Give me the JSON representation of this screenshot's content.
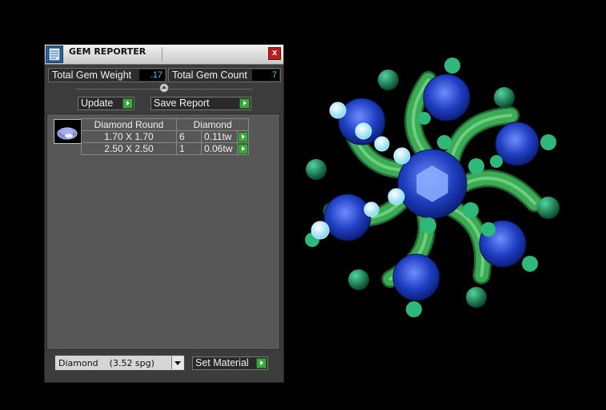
{
  "window": {
    "title": "GEM REPORTER",
    "close_label": "x"
  },
  "stats": {
    "total_weight_label": "Total Gem Weight",
    "total_weight_value": ".17",
    "total_count_label": "Total Gem Count",
    "total_count_value": "7"
  },
  "buttons": {
    "update_label": "Update",
    "save_report_label": "Save Report",
    "set_material_label": "Set Material"
  },
  "table": {
    "headers": [
      "Diamond Round",
      "Diamond"
    ],
    "rows": [
      {
        "size": "1.70 X 1.70",
        "count": "6",
        "weight": "0.11tw"
      },
      {
        "size": "2.50 X 2.50",
        "count": "1",
        "weight": "0.06tw"
      }
    ]
  },
  "material": {
    "selected": "Diamond    (3.52 spg)"
  },
  "colors": {
    "accent_green": "#3fa63f",
    "value_cyan": "#3fd2e6",
    "metal_green": "#3daa55",
    "sapphire_blue": "#1e3fc0"
  },
  "icons": {
    "app": "gem-reporter-icon",
    "close": "close-icon",
    "arrow": "green-arrow-icon",
    "dropdown": "chevron-down-icon"
  }
}
